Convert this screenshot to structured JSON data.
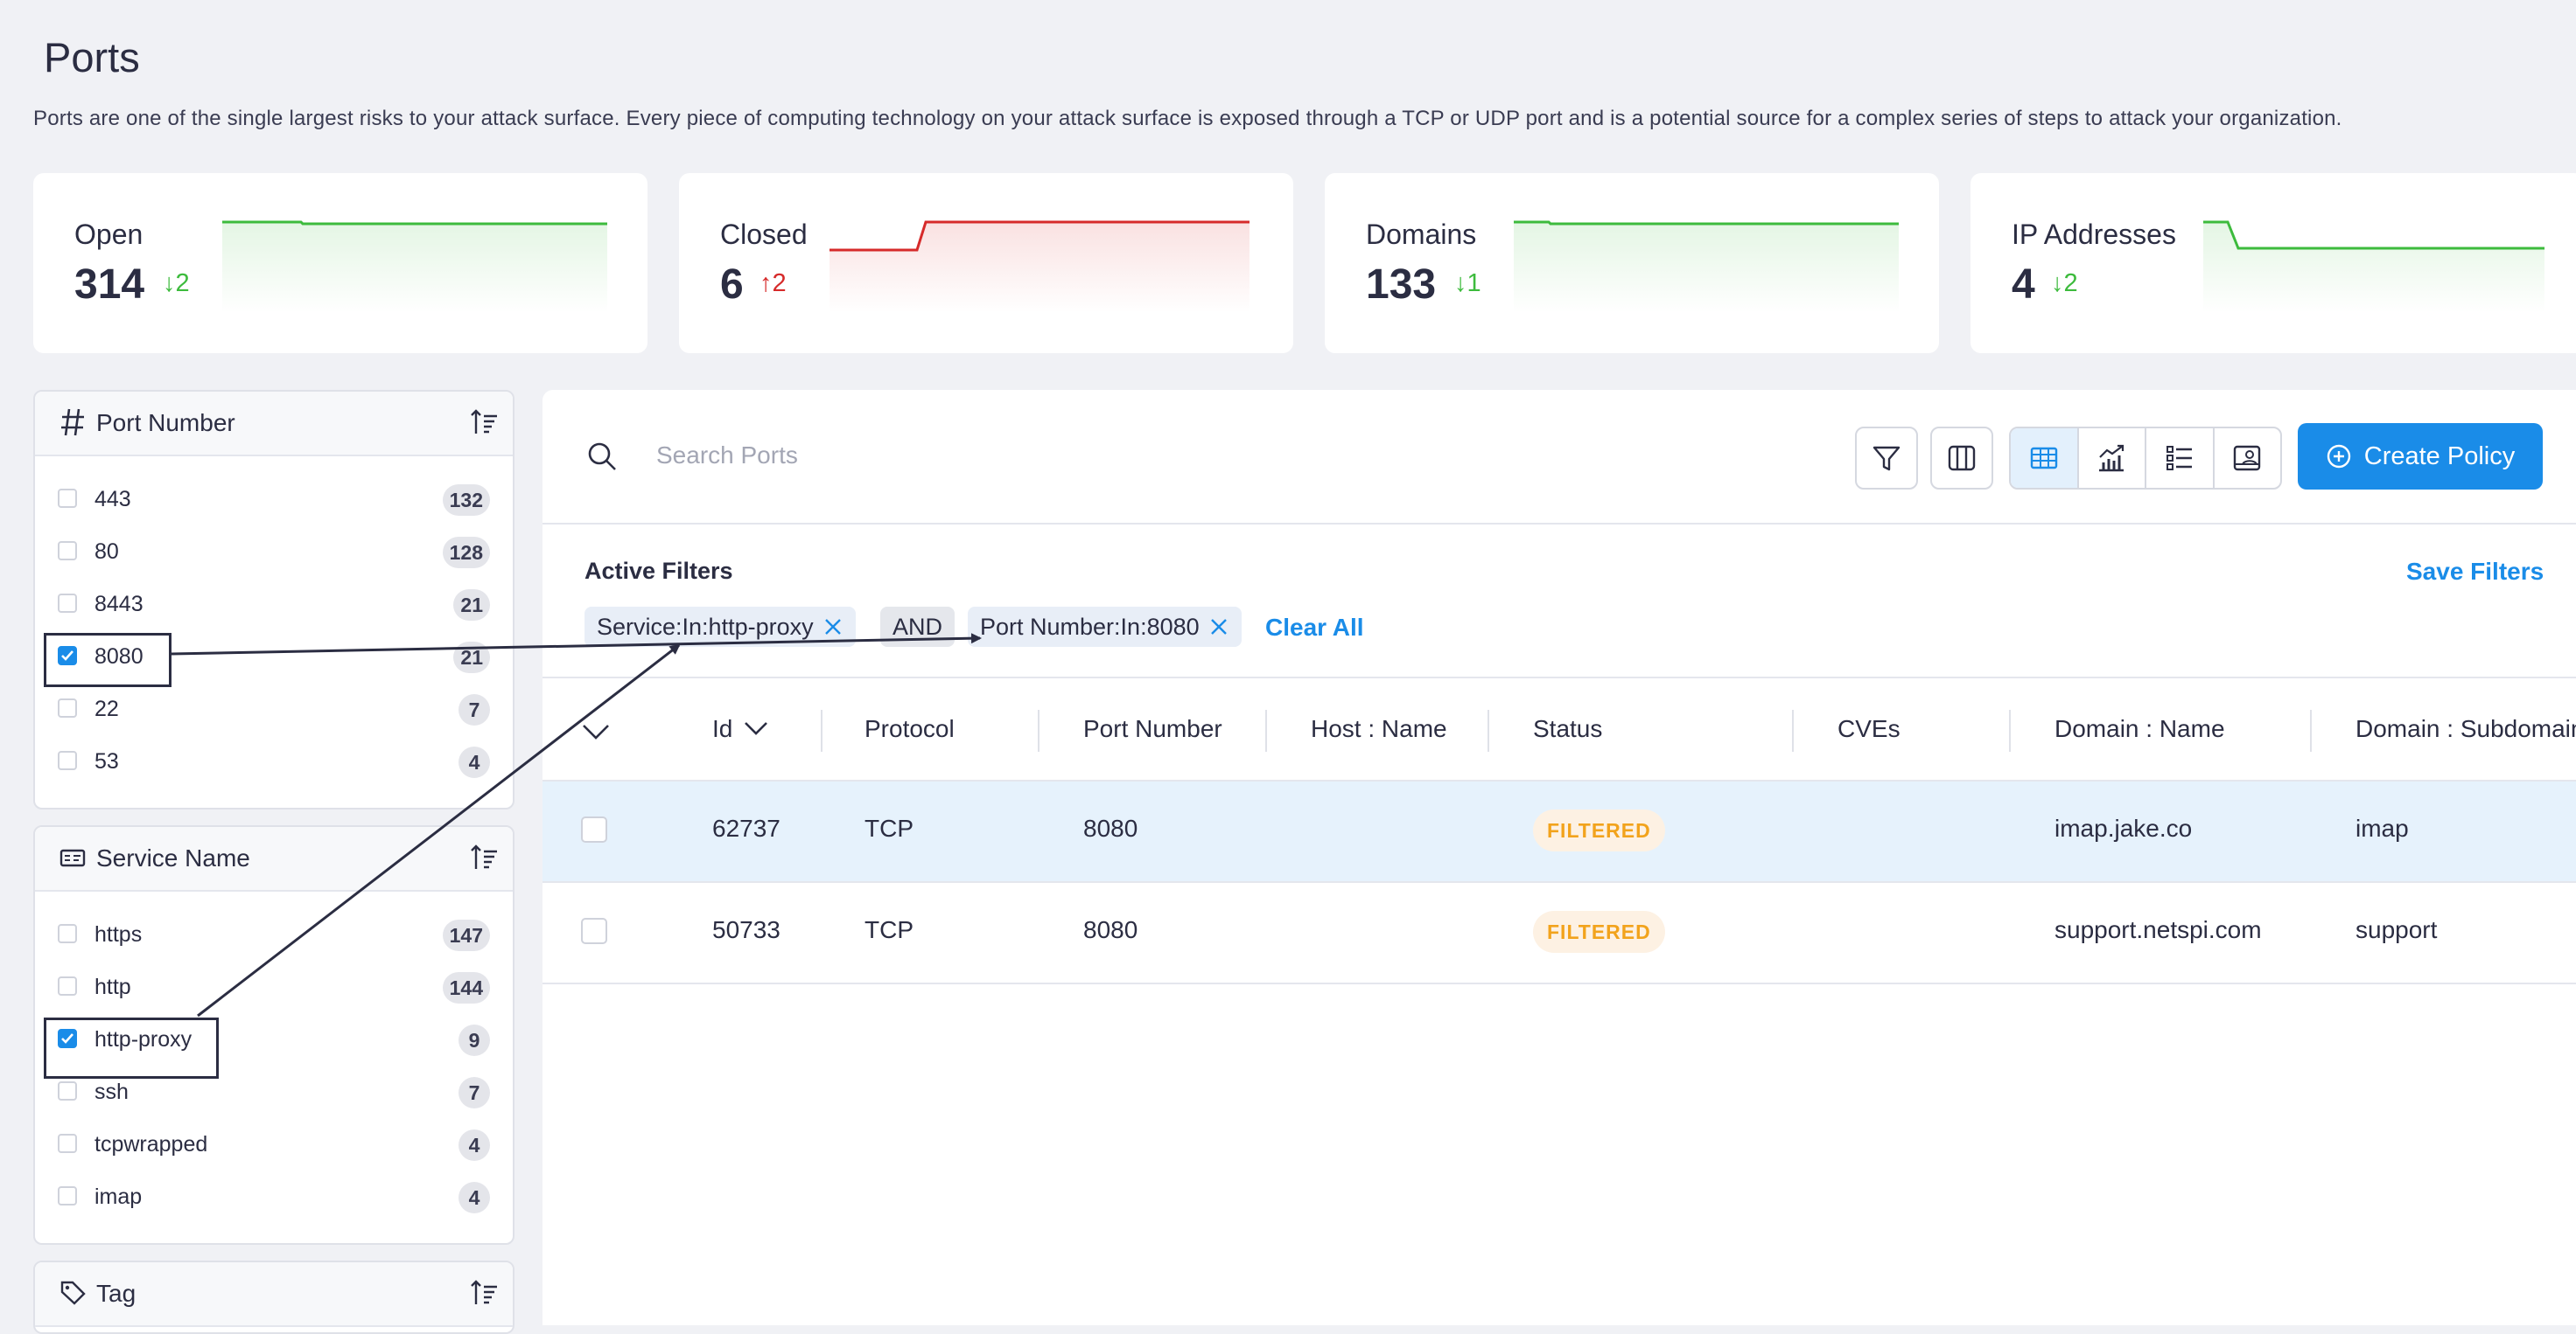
{
  "page": {
    "title": "Ports",
    "description": "Ports are one of the single largest risks to your attack surface. Every piece of computing technology on your attack surface is exposed through a TCP or UDP port and is a potential source for a complex series of steps to attack your organization."
  },
  "cards": [
    {
      "label": "Open",
      "value": "314",
      "delta": "2",
      "direction": "down",
      "color": "#3dbb3d"
    },
    {
      "label": "Closed",
      "value": "6",
      "delta": "2",
      "direction": "up",
      "color": "#d62a2a"
    },
    {
      "label": "Domains",
      "value": "133",
      "delta": "1",
      "direction": "down",
      "color": "#3dbb3d"
    },
    {
      "label": "IP Addresses",
      "value": "4",
      "delta": "2",
      "direction": "down",
      "color": "#3dbb3d"
    }
  ],
  "port_panel": {
    "title": "Port Number",
    "items": [
      {
        "label": "443",
        "count": "132",
        "checked": false
      },
      {
        "label": "80",
        "count": "128",
        "checked": false
      },
      {
        "label": "8443",
        "count": "21",
        "checked": false
      },
      {
        "label": "8080",
        "count": "21",
        "checked": true
      },
      {
        "label": "22",
        "count": "7",
        "checked": false
      },
      {
        "label": "53",
        "count": "4",
        "checked": false
      }
    ]
  },
  "service_panel": {
    "title": "Service Name",
    "items": [
      {
        "label": "https",
        "count": "147",
        "checked": false
      },
      {
        "label": "http",
        "count": "144",
        "checked": false
      },
      {
        "label": "http-proxy",
        "count": "9",
        "checked": true
      },
      {
        "label": "ssh",
        "count": "7",
        "checked": false
      },
      {
        "label": "tcpwrapped",
        "count": "4",
        "checked": false
      },
      {
        "label": "imap",
        "count": "4",
        "checked": false
      }
    ]
  },
  "tag_panel": {
    "title": "Tag"
  },
  "search": {
    "placeholder": "Search Ports"
  },
  "toolbar": {
    "create_label": "Create Policy"
  },
  "filters": {
    "heading": "Active Filters",
    "save_label": "Save Filters",
    "chip_service": "Service:In:http-proxy",
    "chip_and": "AND",
    "chip_port": "Port Number:In:8080",
    "clear_label": "Clear All"
  },
  "table": {
    "columns": [
      "Id",
      "Protocol",
      "Port Number",
      "Host : Name",
      "Status",
      "CVEs",
      "Domain : Name",
      "Domain : Subdomain"
    ],
    "rows": [
      {
        "id": "62737",
        "protocol": "TCP",
        "port": "8080",
        "host": "",
        "status": "FILTERED",
        "cves": "",
        "domain": "imap.jake.co",
        "subdomain": "imap"
      },
      {
        "id": "50733",
        "protocol": "TCP",
        "port": "8080",
        "host": "",
        "status": "FILTERED",
        "cves": "",
        "domain": "support.netspi.com",
        "subdomain": "support"
      }
    ]
  }
}
